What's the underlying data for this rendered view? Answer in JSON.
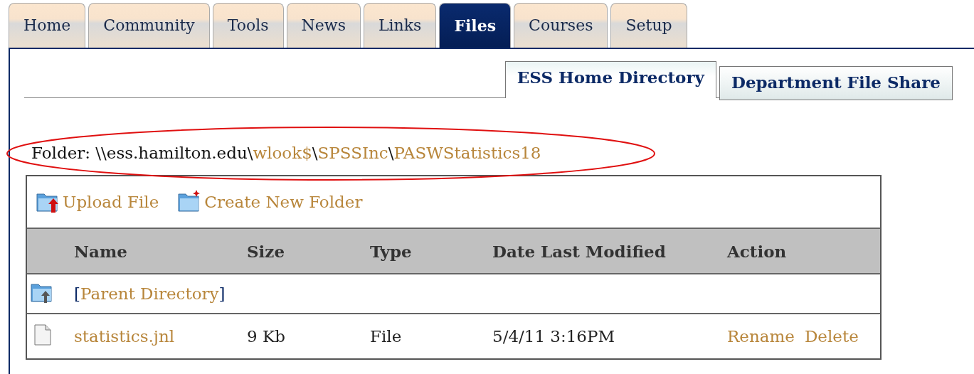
{
  "tabs": [
    {
      "label": "Home",
      "selected": false
    },
    {
      "label": "Community",
      "selected": false
    },
    {
      "label": "Tools",
      "selected": false
    },
    {
      "label": "News",
      "selected": false
    },
    {
      "label": "Links",
      "selected": false
    },
    {
      "label": "Files",
      "selected": true
    },
    {
      "label": "Courses",
      "selected": false
    },
    {
      "label": "Setup",
      "selected": false
    }
  ],
  "sub_tabs": [
    {
      "label": "ESS Home Directory",
      "selected": true
    },
    {
      "label": "Department File Share",
      "selected": false
    }
  ],
  "folder": {
    "label": "Folder:",
    "path": [
      {
        "text": "\\\\ess.hamilton.edu\\",
        "link": false
      },
      {
        "text": "wlook$",
        "link": true
      },
      {
        "text": "\\",
        "link": false
      },
      {
        "text": "SPSSInc",
        "link": true
      },
      {
        "text": "\\",
        "link": false
      },
      {
        "text": "PASWStatistics18",
        "link": true
      }
    ]
  },
  "toolbar": [
    {
      "kind": "upload",
      "label": "Upload File"
    },
    {
      "kind": "new-folder",
      "label": "Create New Folder"
    }
  ],
  "table": {
    "columns": [
      "Name",
      "Size",
      "Type",
      "Date Last Modified",
      "Action"
    ],
    "parent": {
      "open": "[",
      "label": "Parent Directory",
      "close": "]"
    },
    "rows": [
      {
        "name": "statistics.jnl",
        "size": "9 Kb",
        "type": "File",
        "modified": "5/4/11 3:16PM",
        "actions": [
          "Rename",
          "Delete"
        ]
      }
    ]
  }
}
